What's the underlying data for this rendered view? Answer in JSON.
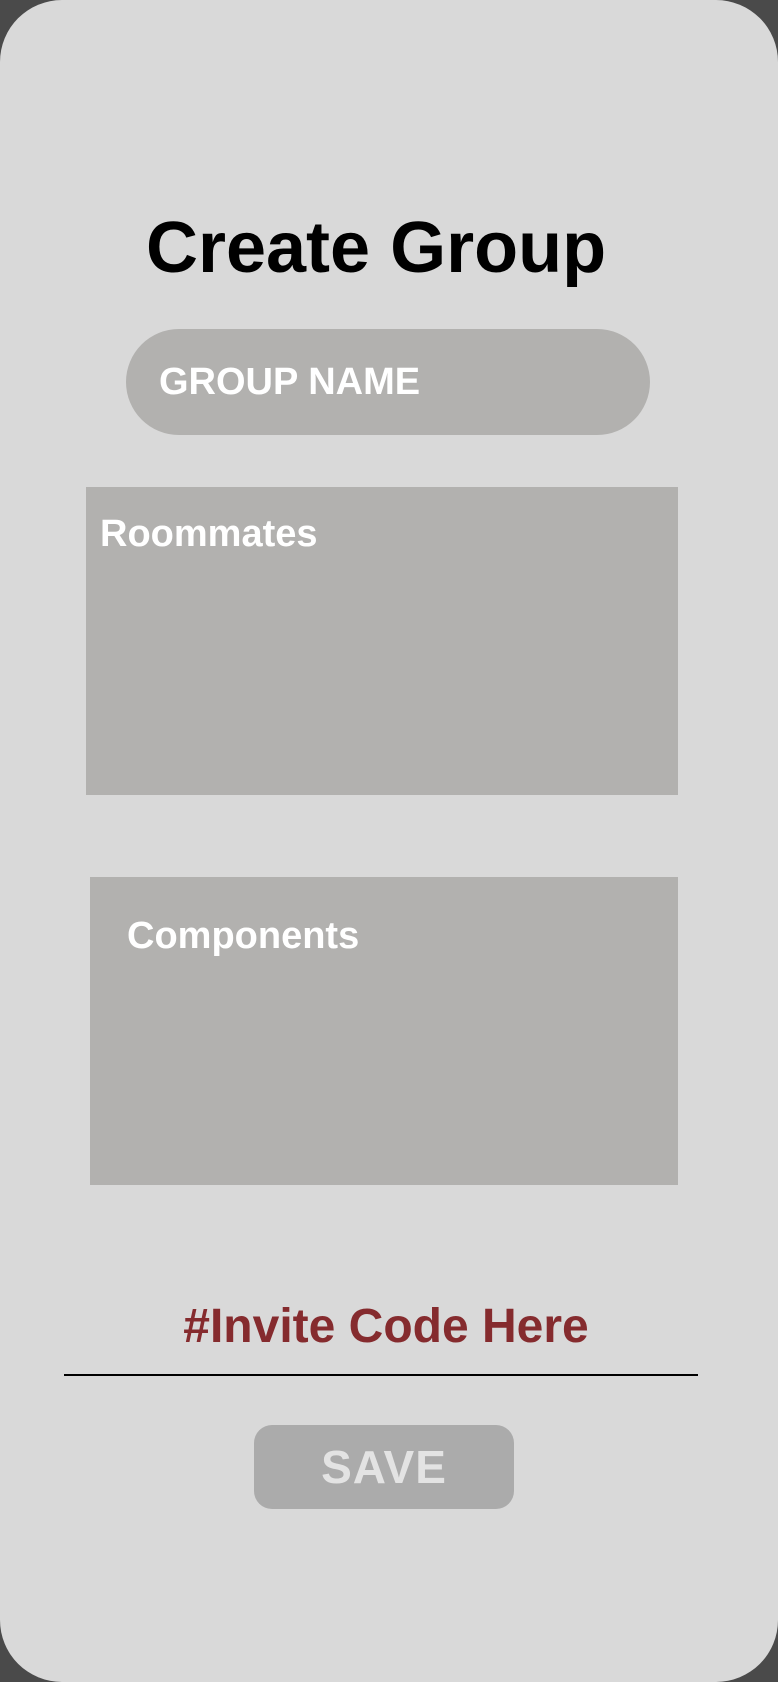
{
  "screen": {
    "title": "Create Group"
  },
  "group_name": {
    "placeholder": "GROUP NAME"
  },
  "roommates": {
    "label": "Roommates"
  },
  "components": {
    "label": "Components"
  },
  "invite": {
    "code_text": "#Invite Code Here"
  },
  "actions": {
    "save_label": "SAVE"
  },
  "colors": {
    "background": "#d9d9d9",
    "panel": "#b2b1af",
    "invite_text": "#852b2e",
    "save_button": "#ababab"
  }
}
